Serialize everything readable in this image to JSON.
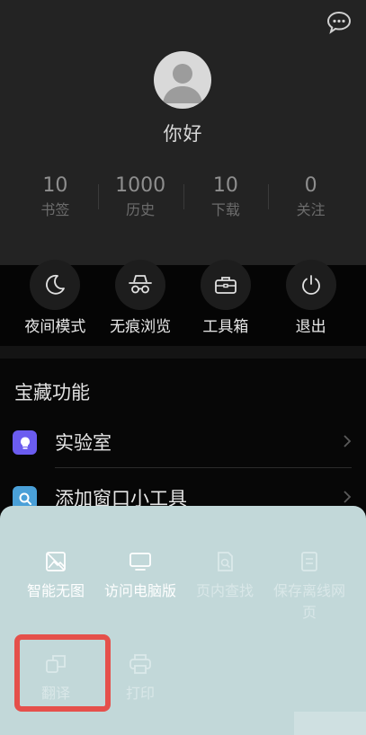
{
  "header": {
    "greeting": "你好",
    "stats": [
      {
        "value": "10",
        "label": "书签"
      },
      {
        "value": "1000",
        "label": "历史"
      },
      {
        "value": "10",
        "label": "下载"
      },
      {
        "value": "0",
        "label": "关注"
      }
    ]
  },
  "quick_actions": [
    {
      "label": "夜间模式",
      "icon": "moon-icon"
    },
    {
      "label": "无痕浏览",
      "icon": "incognito-icon"
    },
    {
      "label": "工具箱",
      "icon": "toolbox-icon"
    },
    {
      "label": "退出",
      "icon": "power-icon"
    }
  ],
  "treasure": {
    "title": "宝藏功能",
    "items": [
      {
        "label": "实验室",
        "icon": "bulb-icon",
        "color": "#6b5cf0"
      },
      {
        "label": "添加窗口小工具",
        "icon": "search-widget-icon",
        "color": "#4aa0d8"
      }
    ]
  },
  "sheet": {
    "tiles": [
      {
        "label": "智能无图",
        "icon": "no-image-icon",
        "enabled": true
      },
      {
        "label": "访问电脑版",
        "icon": "desktop-icon",
        "enabled": true
      },
      {
        "label": "页内查找",
        "icon": "find-in-page-icon",
        "enabled": false
      },
      {
        "label": "保存离线网页",
        "icon": "save-offline-icon",
        "enabled": false
      },
      {
        "label": "翻译",
        "icon": "translate-icon",
        "enabled": false
      },
      {
        "label": "打印",
        "icon": "print-icon",
        "enabled": false
      }
    ]
  },
  "colors": {
    "header_bg": "#232323",
    "sheet_bg": "#c2d8d9",
    "highlight": "#e5504b"
  }
}
